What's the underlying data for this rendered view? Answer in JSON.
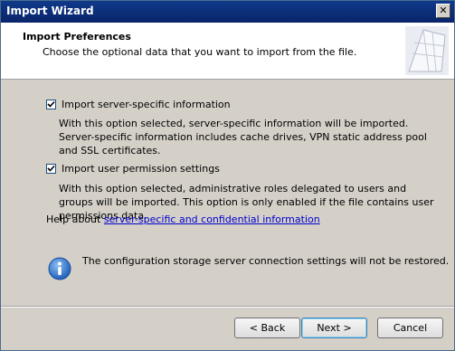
{
  "window": {
    "title": "Import Wizard",
    "close_glyph": "✕"
  },
  "header": {
    "title": "Import Preferences",
    "subtitle": "Choose the optional data that you want to import from the file."
  },
  "options": [
    {
      "label": "Import server-specific information",
      "checked": true,
      "description": "With this option selected, server-specific information will be imported. Server-specific information includes cache drives, VPN static address pool and SSL certificates."
    },
    {
      "label": "Import user permission settings",
      "checked": true,
      "description": "With this option selected, administrative roles delegated to users and groups will be imported. This option is only enabled if the file contains user permissions data."
    }
  ],
  "help": {
    "prefix": "Help about ",
    "link": "server-specific and confidential information"
  },
  "info": {
    "icon": "info-icon",
    "text": "The configuration storage server connection settings will not be restored."
  },
  "buttons": {
    "back": "< Back",
    "next": "Next >",
    "cancel": "Cancel"
  },
  "colors": {
    "titlebar": "#0a246a",
    "dialog_bg": "#d4d0c8",
    "link": "#0000cc",
    "info_icon": "#2b6cc4"
  }
}
